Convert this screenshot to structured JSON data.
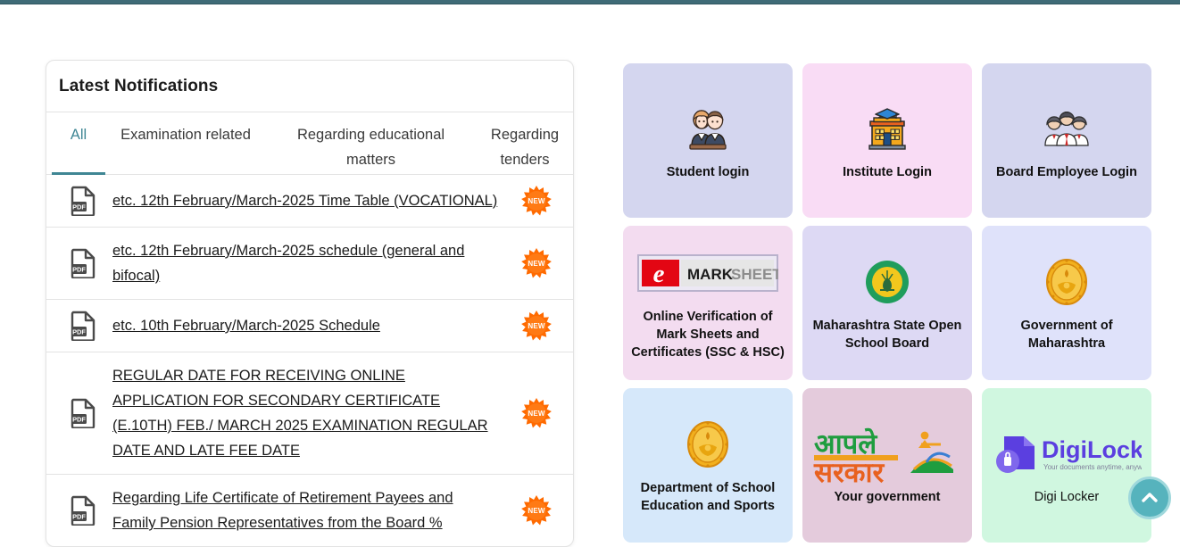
{
  "notifications": {
    "title": "Latest Notifications",
    "tabs": [
      {
        "label": "All",
        "active": true
      },
      {
        "label": "Examination related",
        "active": false
      },
      {
        "label": "Regarding educational matters",
        "active": false
      },
      {
        "label": "Regarding tenders",
        "active": false
      }
    ],
    "badge_text": "NEW",
    "file_icon_label": "PDF",
    "items": [
      {
        "text": "etc. 12th February/March-2025 Time Table (VOCATIONAL)",
        "badge": "NEW",
        "icon": "pdf-icon"
      },
      {
        "text": "etc. 12th February/March-2025 schedule (general and bifocal)",
        "badge": "NEW",
        "icon": "pdf-icon"
      },
      {
        "text": "etc. 10th February/March-2025 Schedule",
        "badge": "NEW",
        "icon": "pdf-icon"
      },
      {
        "text": "REGULAR DATE FOR RECEIVING ONLINE APPLICATION FOR SECONDARY CERTIFICATE (E.10TH) FEB./ MARCH 2025 EXAMINATION REGULAR DATE AND LATE FEE DATE",
        "badge": "NEW",
        "icon": "pdf-icon"
      },
      {
        "text": "Regarding Life Certificate of Retirement Payees and Family Pension Representatives from the Board %",
        "badge": "NEW",
        "icon": "pdf-icon"
      }
    ]
  },
  "cards": [
    {
      "label": "Student login",
      "icon": "students-icon",
      "bg": "#d4d6ef",
      "bold": true
    },
    {
      "label": "Institute Login",
      "icon": "school-building-icon",
      "bg": "#f9dcf5",
      "bold": true
    },
    {
      "label": "Board Employee Login",
      "icon": "employees-group-icon",
      "bg": "#d4d6ef",
      "bold": true
    },
    {
      "label": "Online Verification of Mark Sheets and Certificates (SSC & HSC)",
      "icon": "emarksheet-logo-icon",
      "bg": "#f3dcf0",
      "bold": true
    },
    {
      "label": "Maharashtra State Open School Board",
      "icon": "msosb-emblem-icon",
      "bg": "#ddd9f4",
      "bold": true
    },
    {
      "label": "Government of Maharashtra",
      "icon": "maharashtra-emblem-icon",
      "bg": "#dfe2fa",
      "bold": true
    },
    {
      "label": "Department of School Education and Sports",
      "icon": "maharashtra-emblem-icon",
      "bg": "#d6e8fa",
      "bold": true
    },
    {
      "label": "Your government",
      "icon": "aaple-sarkar-logo-icon",
      "bg": "#e4cbdc",
      "bold": true
    },
    {
      "label": "Digi Locker",
      "icon": "digilocker-logo-icon",
      "bg": "#d0f7e0",
      "bold": false
    }
  ],
  "emarksheet": {
    "e_text": "e",
    "mark_text": "MARK",
    "sheet_text": "SHEET"
  },
  "digilocker": {
    "wordmark": "DigiLocker",
    "tagline": "Your documents anytime, anywhere"
  },
  "aaple_sarkar": {
    "line1": "आपले",
    "line2": "सरकार"
  },
  "scroll_top": {
    "label": "Scroll to top",
    "icon": "chevron-up-icon"
  },
  "colors": {
    "top_bar": "#3f6b77",
    "accent_teal": "#3f8694",
    "badge_orange": "#ff6a00",
    "scroll_button": "#56b3bd"
  }
}
